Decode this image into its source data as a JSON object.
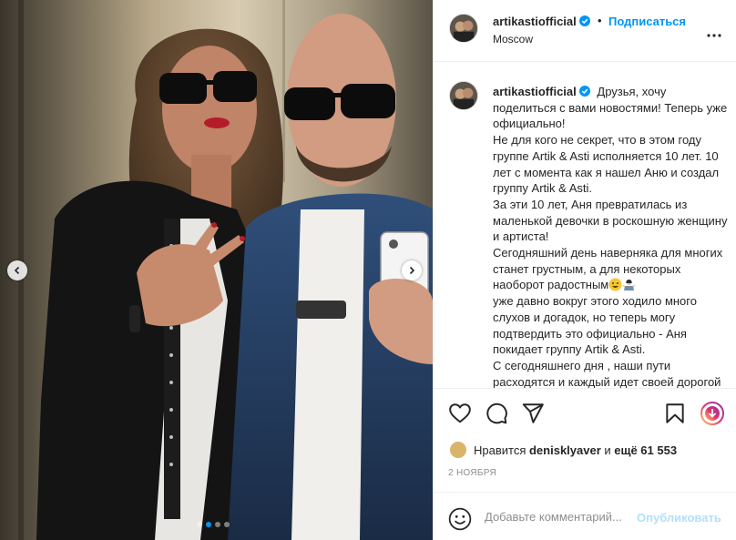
{
  "post": {
    "username": "artikastiofficial",
    "verified": true,
    "follow_label": "Подписаться",
    "separator": "•",
    "location": "Moscow",
    "more_icon": "more-options-icon",
    "photo": {
      "carousel_count": 4,
      "active_index": 1,
      "prev_icon": "chevron-left-icon",
      "next_icon": "chevron-right-icon"
    }
  },
  "caption": {
    "username": "artikastiofficial",
    "lines": [
      "Друзья, хочу поделиться с вами новостями! Теперь уже официально!",
      "Не для кого не секрет, что в этом году группе Artik & Asti исполняется 10 лет. 10 лет с момента как я нашел Аню и создал группу Artik & Asti.",
      "За эти 10 лет, Аня превратилась из маленькой девочки в роскошную женщину и артиста!",
      "Сегодняшний день наверняка для многих станет грустным, а для некоторых наоборот радостным",
      "уже давно вокруг этого ходило много слухов и догадок, но теперь могу подтвердить это официально - Аня покидает группу Artik & Asti.",
      "С сегодняшнего дня , наши пути расходятся и каждый идет своей дорогой"
    ]
  },
  "actions": {
    "like_icon": "heart-icon",
    "comment_icon": "comment-icon",
    "share_icon": "share-icon",
    "save_icon": "bookmark-icon",
    "promo_icon": "promo-badge-icon"
  },
  "likes": {
    "prefix": "Нравится ",
    "user": "denisklyaver",
    "middle": " и ",
    "others": "ещё 61 553"
  },
  "date": "2 НОЯБРЯ",
  "comment": {
    "placeholder": "Добавьте комментарий...",
    "publish_label": "Опубликовать",
    "emoji_icon": "smiley-icon"
  },
  "colors": {
    "accent": "#0095f6",
    "publish_disabled": "#b2dffc",
    "text": "#262626",
    "muted": "#8e8e8e",
    "border": "#efefef"
  }
}
